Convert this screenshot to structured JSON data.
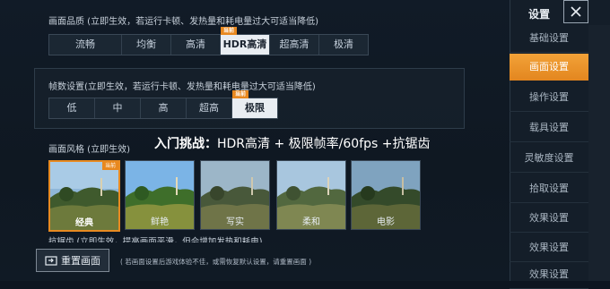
{
  "quality": {
    "label": "画面品质 (立即生效，若运行卡顿、发热量和耗电量过大可适当降低)",
    "options": [
      "流畅",
      "均衡",
      "高清",
      "HDR高清",
      "超高清",
      "极清"
    ],
    "selected_index": 3,
    "current_tag": "当前"
  },
  "fps": {
    "label": "帧数设置(立即生效，若运行卡顿、发热量和耗电量过大可适当降低)",
    "options": [
      "低",
      "中",
      "高",
      "超高",
      "极限"
    ],
    "selected_index": 4,
    "current_tag": "当前"
  },
  "headline": {
    "prefix": "入门挑战：",
    "text": "HDR高清 + 极限帧率/60fps +抗锯齿"
  },
  "style": {
    "label": "画面风格 (立即生效)",
    "options": [
      "经典",
      "鲜艳",
      "写实",
      "柔和",
      "电影"
    ],
    "selected_index": 0,
    "current_tag": "当前"
  },
  "antialias": {
    "label": "抗锯齿 (立即生效，提高画面平滑，但会增加发热和耗电)"
  },
  "bottom": {
    "reset_label": "重置画面",
    "hint": "( 若画面设置后游戏体验不佳，或需恢复默认设置，请重置画面 )"
  },
  "sidebar": {
    "title": "设置",
    "items": [
      "基础设置",
      "画面设置",
      "操作设置",
      "载具设置",
      "灵敏度设置",
      "拾取设置",
      "效果设置",
      "效果设置",
      "效果设置"
    ],
    "active_index": 1
  },
  "colors": {
    "accent": "#e8881f",
    "selected_segment": "#e9edf2",
    "background": "#0d1520"
  }
}
